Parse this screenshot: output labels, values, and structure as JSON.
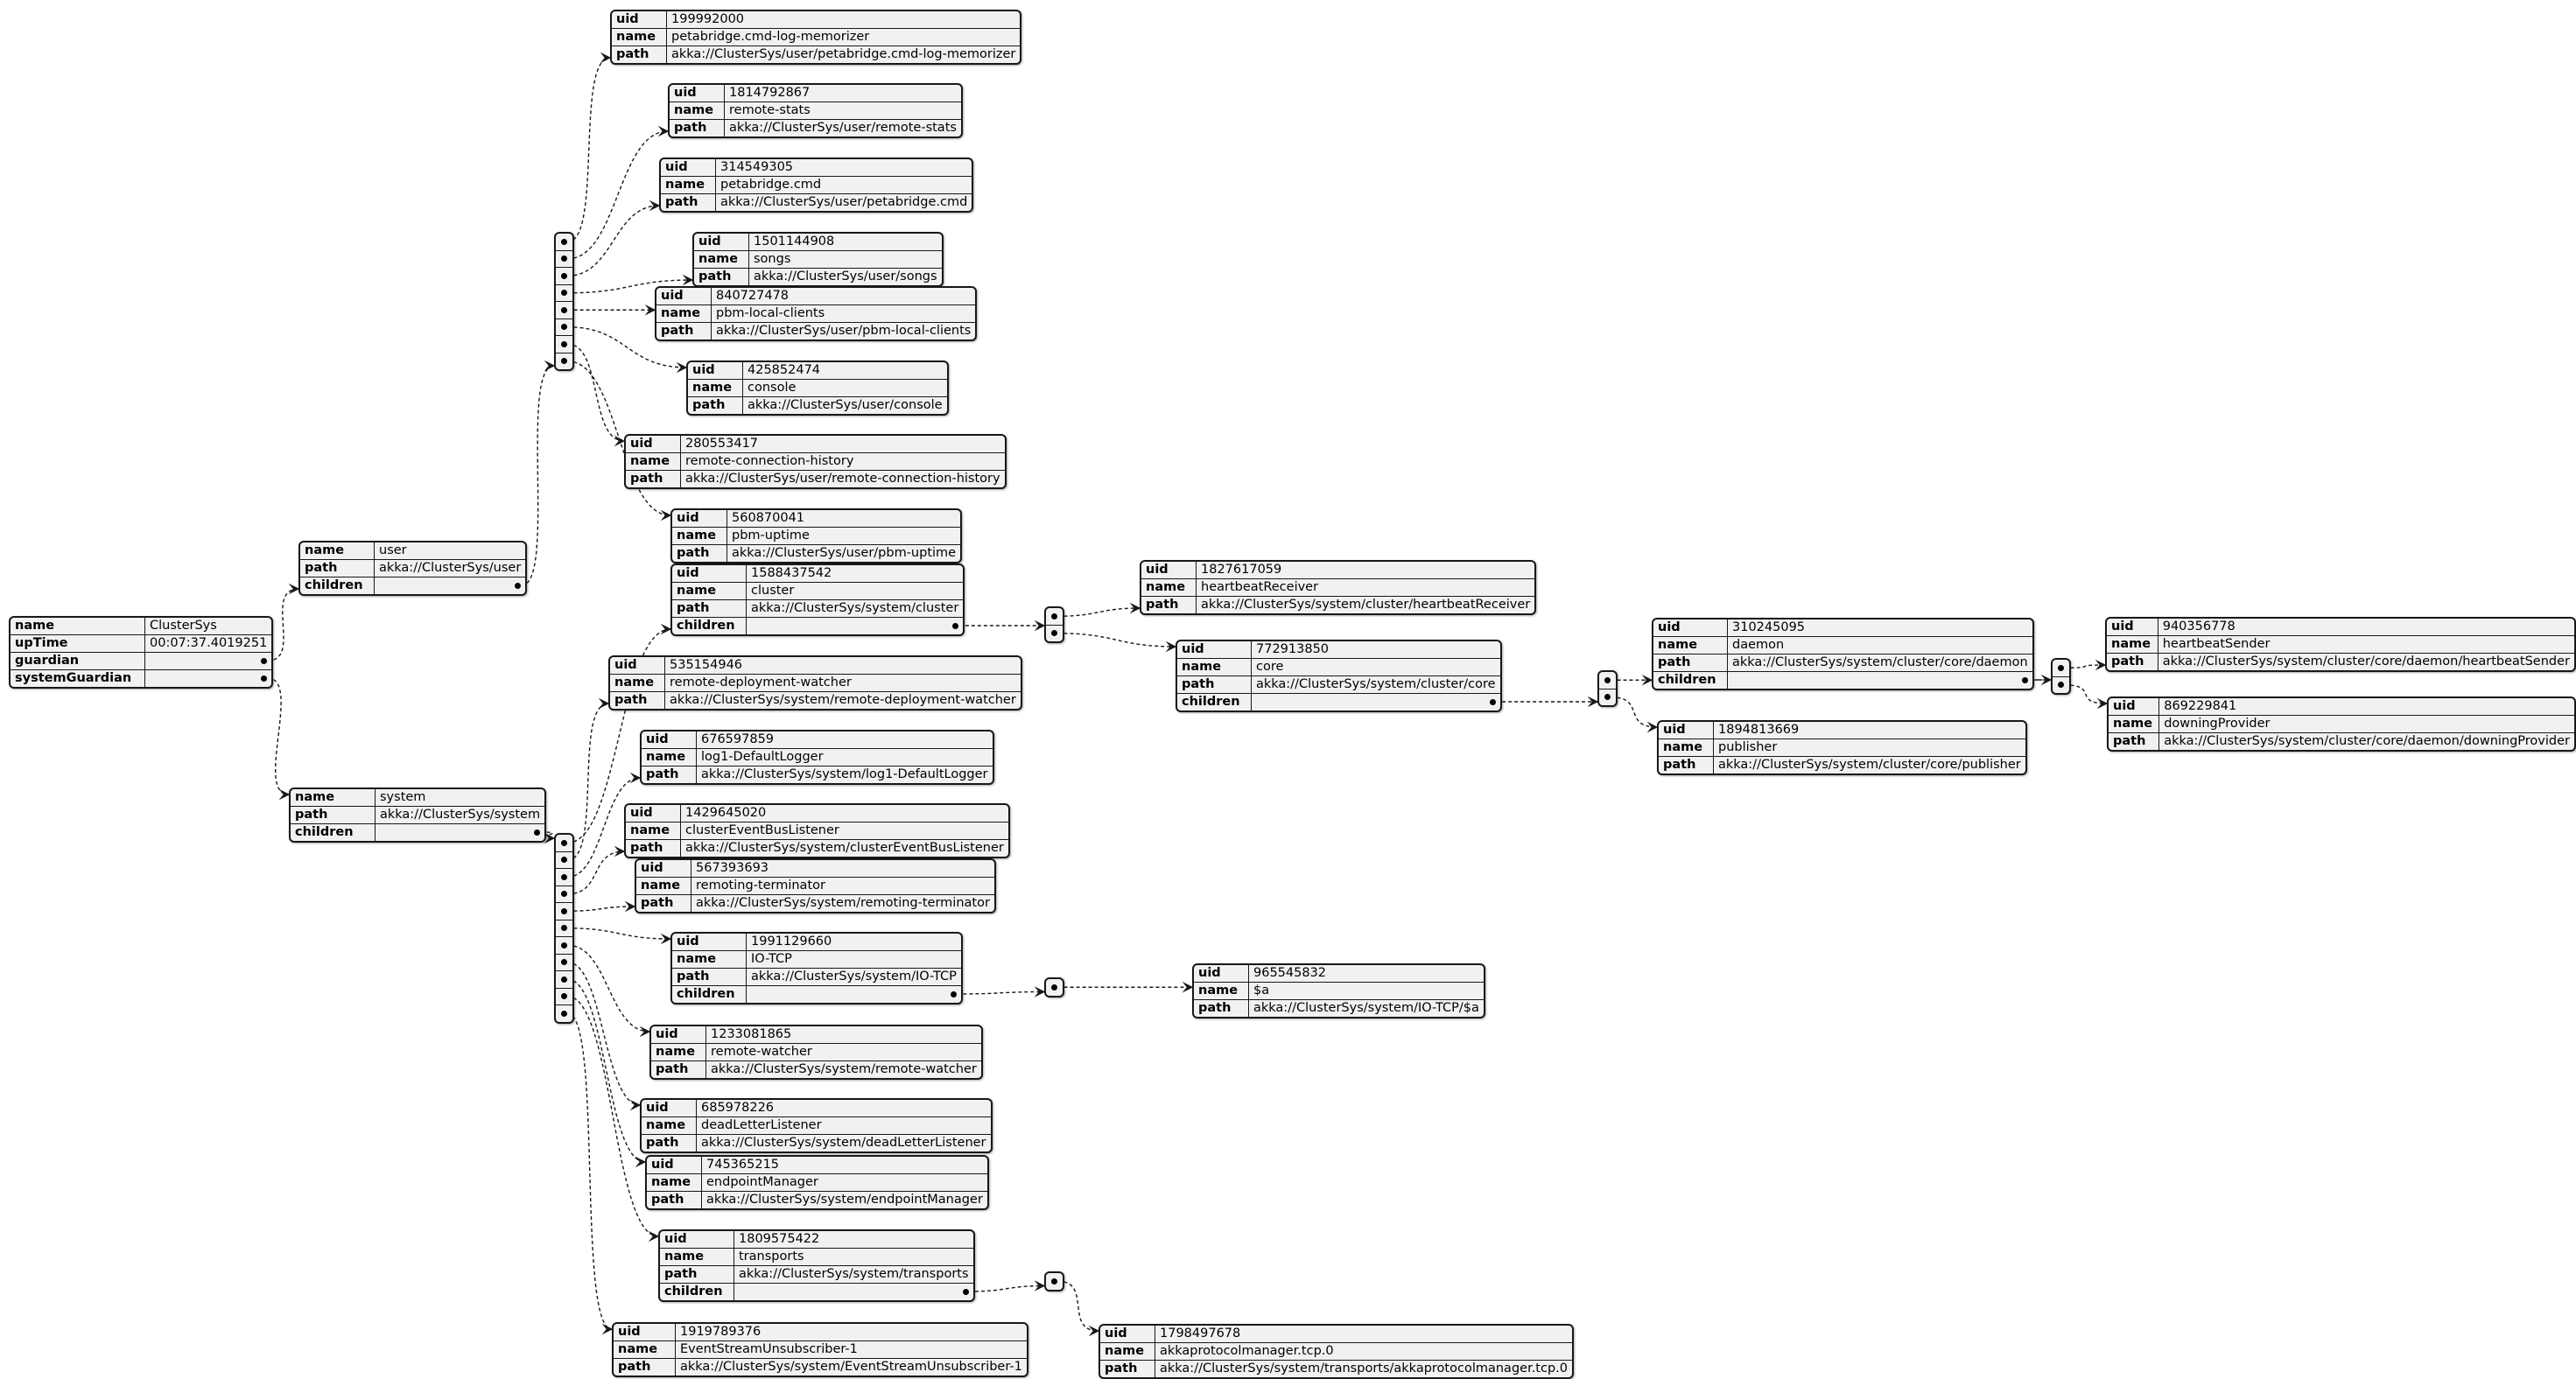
{
  "root": {
    "rows": [
      {
        "key": "name",
        "value": "ClusterSys"
      },
      {
        "key": "upTime",
        "value": "00:07:37.4019251"
      },
      {
        "key": "guardian",
        "value": null
      },
      {
        "key": "systemGuardian",
        "value": null
      }
    ]
  },
  "guardian": {
    "rows": [
      {
        "key": "name",
        "value": "user"
      },
      {
        "key": "path",
        "value": "akka://ClusterSys/user"
      },
      {
        "key": "children",
        "value": null
      }
    ],
    "children": [
      {
        "uid": "199992000",
        "name": "petabridge.cmd-log-memorizer",
        "path": "akka://ClusterSys/user/petabridge.cmd-log-memorizer"
      },
      {
        "uid": "1814792867",
        "name": "remote-stats",
        "path": "akka://ClusterSys/user/remote-stats"
      },
      {
        "uid": "314549305",
        "name": "petabridge.cmd",
        "path": "akka://ClusterSys/user/petabridge.cmd"
      },
      {
        "uid": "1501144908",
        "name": "songs",
        "path": "akka://ClusterSys/user/songs"
      },
      {
        "uid": "840727478",
        "name": "pbm-local-clients",
        "path": "akka://ClusterSys/user/pbm-local-clients"
      },
      {
        "uid": "425852474",
        "name": "console",
        "path": "akka://ClusterSys/user/console"
      },
      {
        "uid": "280553417",
        "name": "remote-connection-history",
        "path": "akka://ClusterSys/user/remote-connection-history"
      },
      {
        "uid": "560870041",
        "name": "pbm-uptime",
        "path": "akka://ClusterSys/user/pbm-uptime"
      }
    ]
  },
  "systemGuardian": {
    "rows": [
      {
        "key": "name",
        "value": "system"
      },
      {
        "key": "path",
        "value": "akka://ClusterSys/system"
      },
      {
        "key": "children",
        "value": null
      }
    ],
    "children": [
      {
        "uid": "1588437542",
        "name": "cluster",
        "path": "akka://ClusterSys/system/cluster",
        "children": [
          {
            "uid": "1827617059",
            "name": "heartbeatReceiver",
            "path": "akka://ClusterSys/system/cluster/heartbeatReceiver"
          },
          {
            "uid": "772913850",
            "name": "core",
            "path": "akka://ClusterSys/system/cluster/core",
            "children": [
              {
                "uid": "310245095",
                "name": "daemon",
                "path": "akka://ClusterSys/system/cluster/core/daemon",
                "children": [
                  {
                    "uid": "940356778",
                    "name": "heartbeatSender",
                    "path": "akka://ClusterSys/system/cluster/core/daemon/heartbeatSender"
                  },
                  {
                    "uid": "869229841",
                    "name": "downingProvider",
                    "path": "akka://ClusterSys/system/cluster/core/daemon/downingProvider"
                  }
                ]
              },
              {
                "uid": "1894813669",
                "name": "publisher",
                "path": "akka://ClusterSys/system/cluster/core/publisher"
              }
            ]
          }
        ]
      },
      {
        "uid": "535154946",
        "name": "remote-deployment-watcher",
        "path": "akka://ClusterSys/system/remote-deployment-watcher"
      },
      {
        "uid": "676597859",
        "name": "log1-DefaultLogger",
        "path": "akka://ClusterSys/system/log1-DefaultLogger"
      },
      {
        "uid": "1429645020",
        "name": "clusterEventBusListener",
        "path": "akka://ClusterSys/system/clusterEventBusListener"
      },
      {
        "uid": "567393693",
        "name": "remoting-terminator",
        "path": "akka://ClusterSys/system/remoting-terminator"
      },
      {
        "uid": "1991129660",
        "name": "IO-TCP",
        "path": "akka://ClusterSys/system/IO-TCP",
        "children": [
          {
            "uid": "965545832",
            "name": "$a",
            "path": "akka://ClusterSys/system/IO-TCP/$a"
          }
        ]
      },
      {
        "uid": "1233081865",
        "name": "remote-watcher",
        "path": "akka://ClusterSys/system/remote-watcher"
      },
      {
        "uid": "685978226",
        "name": "deadLetterListener",
        "path": "akka://ClusterSys/system/deadLetterListener"
      },
      {
        "uid": "745365215",
        "name": "endpointManager",
        "path": "akka://ClusterSys/system/endpointManager"
      },
      {
        "uid": "1809575422",
        "name": "transports",
        "path": "akka://ClusterSys/system/transports",
        "children": [
          {
            "uid": "1798497678",
            "name": "akkaprotocolmanager.tcp.0",
            "path": "akka://ClusterSys/system/transports/akkaprotocolmanager.tcp.0"
          }
        ]
      },
      {
        "uid": "1919789376",
        "name": "EventStreamUnsubscriber-1",
        "path": "akka://ClusterSys/system/EventStreamUnsubscriber-1"
      }
    ]
  },
  "labels": {
    "uid": "uid",
    "name": "name",
    "path": "path",
    "children": "children"
  }
}
